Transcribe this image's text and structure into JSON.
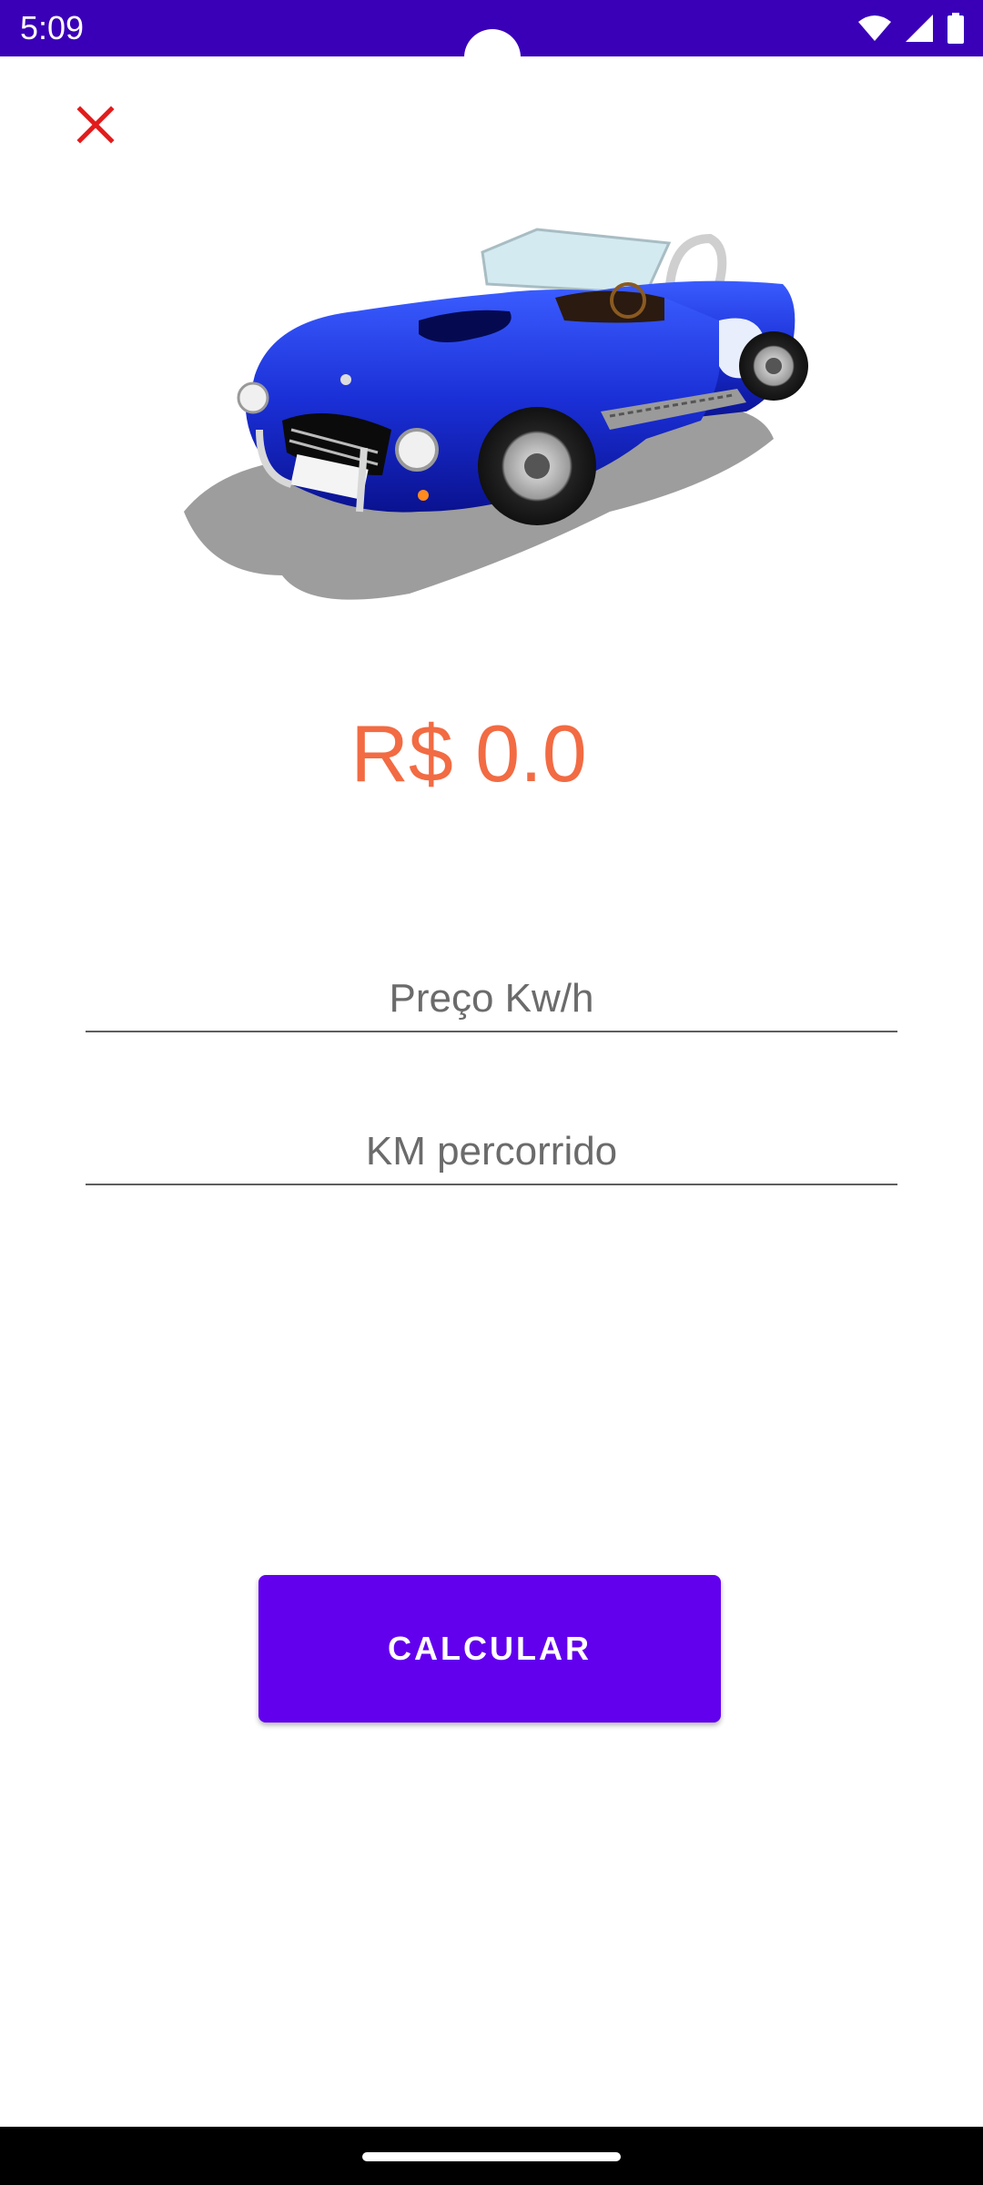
{
  "status_bar": {
    "time": "5:09",
    "background_color": "#3a00b8",
    "icons": [
      "wifi-icon",
      "signal-icon",
      "battery-icon"
    ]
  },
  "toolbar": {
    "close_icon": "close-icon",
    "close_color": "#e31b1b"
  },
  "hero": {
    "image": "blue-convertible-car"
  },
  "result": {
    "price": "R$ 0.0",
    "color": "#f26b43"
  },
  "form": {
    "kwh_price": {
      "placeholder": "Preço Kw/h",
      "value": ""
    },
    "km": {
      "placeholder": "KM percorrido",
      "value": ""
    }
  },
  "actions": {
    "calculate_label": "CALCULAR",
    "button_color": "#6200ee"
  }
}
